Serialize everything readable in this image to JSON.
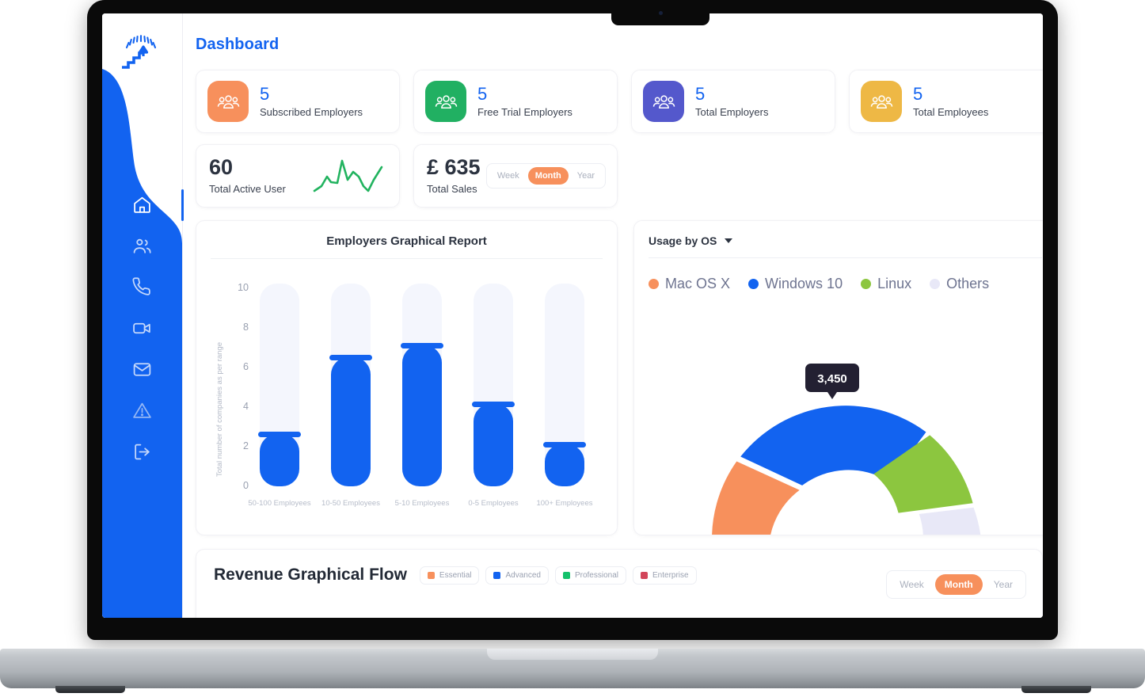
{
  "app": {
    "logo_name": "stairs-growth-logo",
    "page_title": "Dashboard"
  },
  "sidebar": {
    "items": [
      {
        "icon": "home-icon",
        "name": "sidebar-item-home",
        "active": true
      },
      {
        "icon": "users-icon",
        "name": "sidebar-item-users",
        "active": false
      },
      {
        "icon": "phone-icon",
        "name": "sidebar-item-calls",
        "active": false
      },
      {
        "icon": "video-icon",
        "name": "sidebar-item-video",
        "active": false
      },
      {
        "icon": "mail-icon",
        "name": "sidebar-item-mail",
        "active": false
      },
      {
        "icon": "alert-triangle-icon",
        "name": "sidebar-item-alerts",
        "active": false
      },
      {
        "icon": "logout-icon",
        "name": "sidebar-item-logout",
        "active": false
      }
    ],
    "background_color": "#1263f0"
  },
  "stats": [
    {
      "value": "5",
      "label": "Subscribed Employers",
      "color": "#f7905c",
      "icon": "group-people-icon"
    },
    {
      "value": "5",
      "label": "Free Trial Employers",
      "color": "#21b062",
      "icon": "group-people-icon"
    },
    {
      "value": "5",
      "label": "Total Employers",
      "color": "#5458cc",
      "icon": "group-people-icon"
    },
    {
      "value": "5",
      "label": "Total Employees",
      "color": "#eeb845",
      "icon": "group-people-icon"
    }
  ],
  "active_user_card": {
    "value": "60",
    "label": "Total Active User",
    "sparkline_color": "#22b35f"
  },
  "sales_card": {
    "value": "£ 635",
    "label": "Total Sales",
    "range_options": [
      "Week",
      "Month",
      "Year"
    ],
    "range_selected": "Month",
    "accent_color": "#f7905c"
  },
  "usage_panel": {
    "title": "Usage by OS",
    "legend": [
      {
        "label": "Mac OS X",
        "color": "#f7905c"
      },
      {
        "label": "Windows 10",
        "color": "#1263f0"
      },
      {
        "label": "Linux",
        "color": "#8cc63f"
      },
      {
        "label": "Others",
        "color": "#e8e8f7"
      }
    ],
    "tooltip_value": "3,450"
  },
  "revenue": {
    "title": "Revenue Graphical Flow",
    "legend": [
      {
        "label": "Essential",
        "color": "#f7905c"
      },
      {
        "label": "Advanced",
        "color": "#1263f0"
      },
      {
        "label": "Professional",
        "color": "#14c16b"
      },
      {
        "label": "Enterprise",
        "color": "#d2455a"
      }
    ],
    "range_options": [
      "Week",
      "Month",
      "Year"
    ],
    "range_selected": "Month",
    "accent_color": "#f7905c"
  },
  "chart_data": [
    {
      "type": "bar",
      "title": "Employers Graphical Report",
      "xlabel": "",
      "ylabel": "Total number of companies as per range",
      "categories": [
        "50-100 Employees",
        "10-50 Employees",
        "5-10 Employees",
        "0-5 Employees",
        "100+ Employees"
      ],
      "values": [
        2.6,
        6.4,
        7.0,
        4.1,
        2.1
      ],
      "ylim": [
        0,
        10
      ],
      "yticks": [
        0,
        2,
        4,
        6,
        8,
        10
      ],
      "bar_color": "#1263f0",
      "track_color": "#f4f6fd",
      "grid": false,
      "legend_position": "none"
    },
    {
      "type": "pie",
      "title": "Usage by OS",
      "subtitle": "semi-donut gauge",
      "categories": [
        "Mac OS X",
        "Windows 10",
        "Linux",
        "Others"
      ],
      "values": [
        30,
        40,
        15,
        15
      ],
      "colors": [
        "#f7905c",
        "#1263f0",
        "#8cc63f",
        "#e8e8f7"
      ],
      "annotations": [
        "3,450"
      ],
      "legend_position": "top"
    }
  ]
}
